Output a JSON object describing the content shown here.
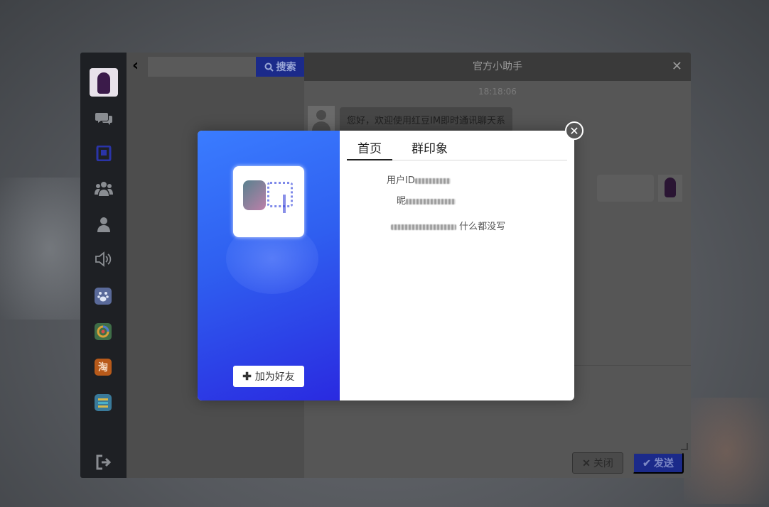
{
  "search": {
    "button_label": "搜索",
    "placeholder": ""
  },
  "rail": {
    "icons": [
      "chat-icon",
      "contacts-card-icon",
      "group-icon",
      "user-icon",
      "speaker-icon"
    ],
    "apps": [
      {
        "name": "baidu-app-icon",
        "glyph": "du",
        "color": "#5a6a9a"
      },
      {
        "name": "tencent-news-app-icon",
        "glyph": "◐",
        "color": "#4a8a4a"
      },
      {
        "name": "taobao-app-icon",
        "glyph": "淘",
        "color": "#b85a1a"
      },
      {
        "name": "list-app-icon",
        "glyph": "≡",
        "color": "#3a7a9a"
      }
    ],
    "logout_icon": "logout-icon"
  },
  "chat": {
    "title": "官方小助手",
    "timestamp": "18:18:06",
    "message": "您好，欢迎使用红豆IM即时通讯聊天系",
    "close_label": "关闭",
    "send_label": "发送"
  },
  "profile": {
    "tabs": [
      "首页",
      "群印象"
    ],
    "user_id_label": "用户ID",
    "nick_label": "昵",
    "signature_tail": "什么都没写",
    "add_friend_label": "加为好友"
  }
}
